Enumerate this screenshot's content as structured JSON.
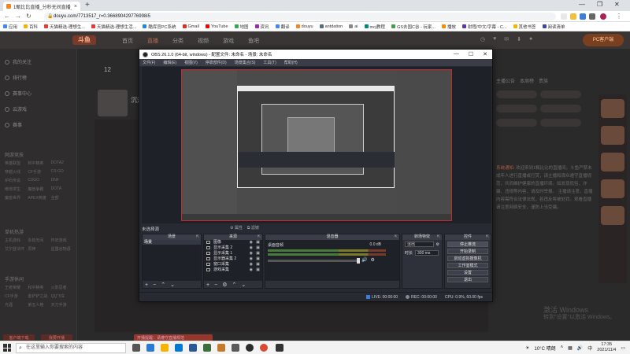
{
  "browser": {
    "tab_title": "1甄比比直播_分秒无间直播_斗鱼",
    "url": "douyu.com/7713517_r=0.366890429776998i5",
    "bookmarks": [
      "应用",
      "百科",
      "天猫精选-理想生...",
      "天猫精选-理想生活...",
      "酷库官PC系统",
      "Gmail",
      "YouTube",
      "地图",
      "资讯",
      "翻译",
      "douyu",
      "antdation",
      "ai",
      "mcj教程",
      "GS去国C谷 - 玩家...",
      "播放",
      "射程/中文/字幕 - C...",
      "其他书签",
      "阅读清单"
    ]
  },
  "site": {
    "logo": "斗鱼",
    "nav": [
      "首页",
      "直播",
      "分类",
      "视频",
      "游戏",
      "鱼吧"
    ],
    "pc_client": "PC客户端",
    "follow_count": "12",
    "streamer_name": "沉清",
    "sidebar": {
      "items": [
        "我的关注",
        "排行榜",
        "赛事中心",
        "云游戏",
        "赛事"
      ],
      "section_games": "网游竞技",
      "games": [
        "英雄联盟",
        "和平精英",
        "DOTA2",
        "穿越火线",
        "CF手游",
        "CS:GO",
        "炉石传说",
        "CSGO",
        "DNF",
        "绝地求生",
        "魔兽争霸",
        "DOTA",
        "魔兽世界",
        "APEX英雄",
        "全部"
      ],
      "section_ent": "单机热游",
      "ent": [
        "主机游戏",
        "永劫无间",
        "怀旧游戏",
        "艾尔登法环",
        "原神",
        "星露谷物语"
      ],
      "section_more": "手游休闲",
      "more": [
        "王者荣耀",
        "和平精英",
        "火影忍者",
        "CF手游",
        "金铲铲之战",
        "QQ飞车",
        "光遇",
        "第五人格",
        "天刀手游"
      ],
      "btn_left": "客户端下载",
      "btn_right": "我要开播"
    },
    "right": {
      "tabs": [
        "主播公告",
        "本周榜",
        "贵族"
      ],
      "announcement_label": "系统通知:",
      "announcement": "欢迎来到1甄比比的直播间。斗鱼严禁未成年人进行直播或打赏，请主播和观众遵守直播规范，共同维护健康的直播环境。如发现低俗、诈骗、违规等内容，请及时举报。 主播请注意，直播内容需符合法律法规，若违反将被处罚。观看直播请注意网络安全，谨防上当受骗。"
    },
    "watermark": [
      "激活 Windows",
      "转到\"设置\"以激活 Windows。"
    ]
  },
  "obs": {
    "title": "OBS 26.1.0 (64-bit, windows) - 配置文件: 未命名 - 场景: 未命名",
    "menu": [
      "文件(F)",
      "编辑(E)",
      "视图(V)",
      "停靠部件(D)",
      "场景集合(S)",
      "工具(T)",
      "帮助(H)"
    ],
    "scene_label": "未选择源",
    "top_tabs": [
      "属性",
      "滤镜"
    ],
    "docks": {
      "scenes": "场景",
      "sources": "来源",
      "mixer": "混音器",
      "transitions": "转场特效",
      "controls": "控件"
    },
    "scene_items": [
      "场景"
    ],
    "sources": [
      "图像",
      "显示采集 2",
      "显示采集 1",
      "显示器采集 2",
      "窗口采集",
      "游戏采集"
    ],
    "mixer": {
      "name": "桌面音频",
      "db": "0.0 dB"
    },
    "transition": {
      "type": "淡出",
      "duration_label": "时长",
      "duration": "300 ms"
    },
    "controls": [
      "停止推流",
      "开始录制",
      "启动虚拟摄像机",
      "工作室模式",
      "设置",
      "退出"
    ],
    "status": {
      "live": "LIVE: 00:00:00",
      "rec": "REC: 00:00:00",
      "cpu": "CPU: 0.9%, 60.00 fps"
    }
  },
  "toast": "开播提醒：请遵守直播规范",
  "taskbar": {
    "search_placeholder": "在这里输入你要搜索的内容",
    "weather": "10°C 晴朗",
    "time": "17:35",
    "date": "2021/11/4",
    "ime": "中"
  },
  "colors": {
    "douyu_brand": "#f48622",
    "obs_bg": "#272a33",
    "accent_red": "#c02b2b"
  }
}
